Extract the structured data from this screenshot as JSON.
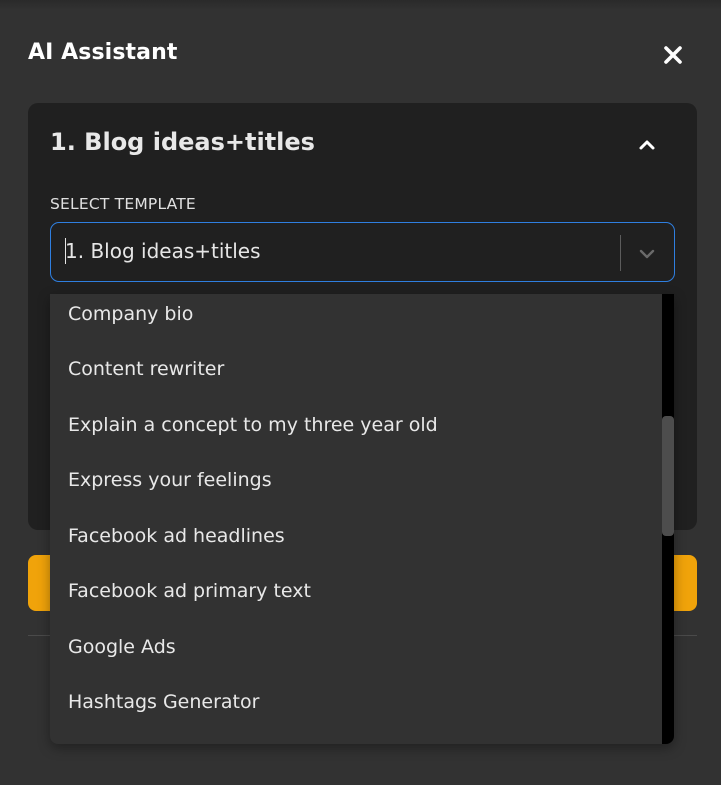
{
  "panel": {
    "title": "AI Assistant",
    "close_icon": "close-icon"
  },
  "card": {
    "title": "1. Blog ideas+titles",
    "collapse_icon": "chevron-up-icon"
  },
  "template_select": {
    "label": "SELECT TEMPLATE",
    "value": "1. Blog ideas+titles",
    "dropdown_icon": "chevron-down-icon",
    "focus_color": "#2f7fe0"
  },
  "dropdown": {
    "options": [
      "Company bio",
      "Content rewriter",
      "Explain a concept to my three year old",
      "Express your feelings",
      "Facebook ad headlines",
      "Facebook ad primary text",
      "Google Ads",
      "Hashtags Generator"
    ]
  },
  "colors": {
    "background": "#323232",
    "card": "#202020",
    "accent_button": "#f0a30a"
  }
}
